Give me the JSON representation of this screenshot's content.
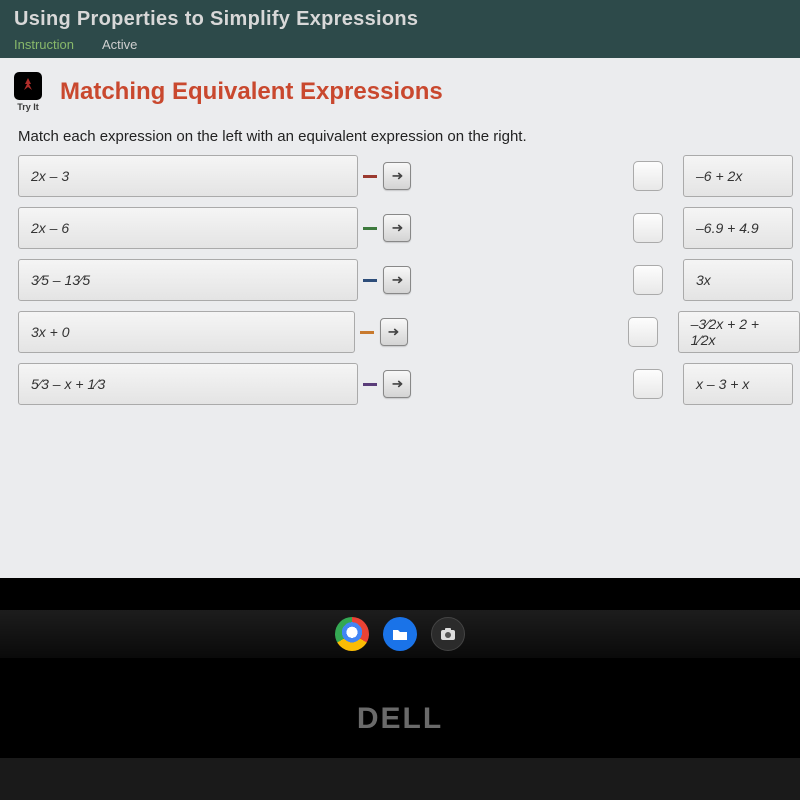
{
  "header": {
    "page_title": "Using Properties to Simplify Expressions",
    "tabs": [
      {
        "label": "Instruction",
        "active": true
      },
      {
        "label": "Active",
        "active": false
      }
    ]
  },
  "content": {
    "tryit_label": "Try It",
    "section_title": "Matching Equivalent Expressions",
    "instruction": "Match each expression on the left with an equivalent expression on the right."
  },
  "rows": [
    {
      "left": "2x – 3",
      "right": "–6 + 2x",
      "color": "c-red"
    },
    {
      "left": "2x – 6",
      "right": "–6.9 + 4.9",
      "color": "c-green"
    },
    {
      "left": "3⁄5 – 13⁄5",
      "right": "3x",
      "color": "c-blue"
    },
    {
      "left": "3x + 0",
      "right": "–3⁄2x + 2 + 1⁄2x",
      "color": "c-orange"
    },
    {
      "left": "5⁄3 – x + 1⁄3",
      "right": "x – 3 + x",
      "color": "c-purple"
    }
  ],
  "taskbar": {
    "icons": [
      "chrome",
      "files",
      "camera"
    ]
  },
  "brand": "DELL"
}
